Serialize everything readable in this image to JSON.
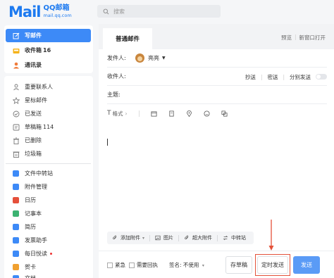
{
  "header": {
    "logo_mark": "Mail",
    "logo_brand": "QQ邮箱",
    "logo_domain": "mail.qq.com",
    "search_placeholder": "搜索"
  },
  "sidebar": {
    "primary": [
      {
        "label": "写邮件",
        "icon": "pen-icon",
        "active": true
      },
      {
        "label": "收件箱",
        "count": "16",
        "icon": "inbox-icon"
      },
      {
        "label": "通讯录",
        "icon": "contacts-icon"
      }
    ],
    "folders": [
      {
        "label": "重要联系人",
        "icon": "person-icon"
      },
      {
        "label": "星标邮件",
        "icon": "star-icon"
      },
      {
        "label": "已发送",
        "icon": "check-circle-icon"
      },
      {
        "label": "草稿箱",
        "count": "114",
        "icon": "draft-icon"
      },
      {
        "label": "已删除",
        "icon": "trash-icon"
      },
      {
        "label": "垃圾箱",
        "icon": "spam-icon"
      }
    ],
    "apps": [
      {
        "label": "文件中转站",
        "icon": "transfer-icon",
        "color": "#3d8af7"
      },
      {
        "label": "附件管理",
        "icon": "attachment-manage-icon",
        "color": "#3d8af7"
      },
      {
        "label": "日历",
        "icon": "calendar-icon",
        "color": "#e5503b"
      },
      {
        "label": "记事本",
        "icon": "notebook-icon",
        "color": "#3cb371"
      },
      {
        "label": "简历",
        "icon": "resume-icon",
        "color": "#3d8af7"
      },
      {
        "label": "发票助手",
        "icon": "invoice-icon",
        "color": "#3d8af7"
      },
      {
        "label": "每日悦读",
        "icon": "reading-icon",
        "color": "#3d8af7",
        "dot": true
      },
      {
        "label": "贺卡",
        "icon": "card-icon",
        "color": "#f0a030"
      },
      {
        "label": "文档",
        "icon": "document-icon",
        "color": "#3d8af7"
      }
    ]
  },
  "compose": {
    "tab_label": "普通邮件",
    "preview_label": "预览",
    "new_window_label": "新窗口打开",
    "sender_label": "发件人:",
    "sender_name": "亮亮",
    "recipient_label": "收件人:",
    "cc_label": "抄送",
    "bcc_label": "密送",
    "separate_send_label": "分别发送",
    "subject_label": "主题:",
    "format_label": "格式",
    "attachments": {
      "add_label": "添加附件",
      "image_label": "图片",
      "large_label": "超大附件",
      "transfer_label": "中转站"
    },
    "footer": {
      "urgent_label": "紧急",
      "receipt_label": "需要回执",
      "signature_label": "签名: 不使用",
      "draft_button": "存草稿",
      "timed_send_button": "定时发送",
      "send_button": "发送"
    }
  },
  "colors": {
    "accent": "#3d8af7",
    "send_button": "#5a9bf6",
    "highlight": "#e4523a"
  }
}
